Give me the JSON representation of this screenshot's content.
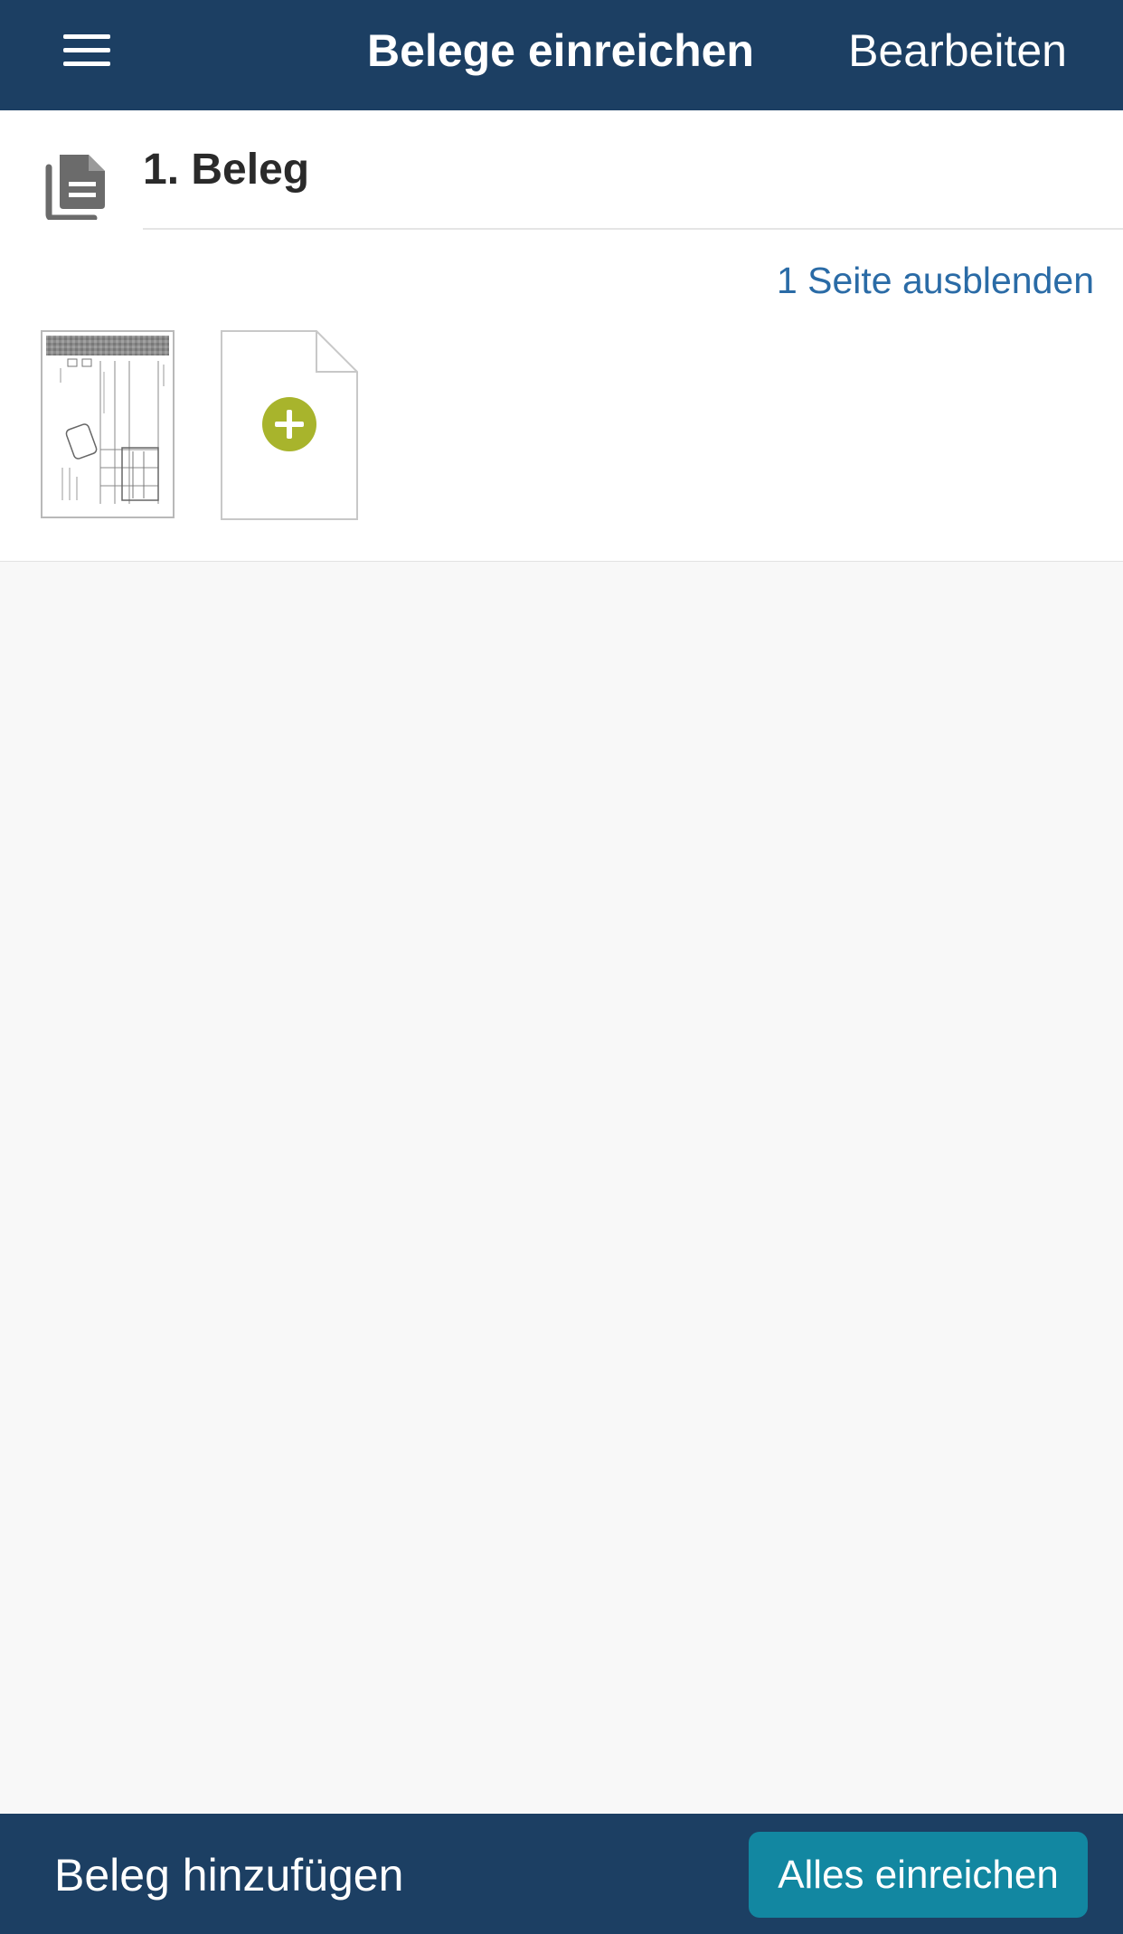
{
  "header": {
    "title": "Belege einreichen",
    "edit_label": "Bearbeiten",
    "menu_icon": "hamburger-menu-icon"
  },
  "beleg": {
    "title": "1. Beleg",
    "icon": "document-copy-icon",
    "toggle_pages_label": "1 Seite ausblenden",
    "pages_count": 1,
    "add_page_icon": "plus-circle-icon"
  },
  "footer": {
    "add_beleg_label": "Beleg hinzufügen",
    "submit_all_label": "Alles einreichen"
  },
  "colors": {
    "bar_background": "#1c3f63",
    "link": "#2a6ba6",
    "add_accent": "#a8b42c",
    "primary_button": "#1287a1",
    "page_background": "#f8f8f8"
  }
}
